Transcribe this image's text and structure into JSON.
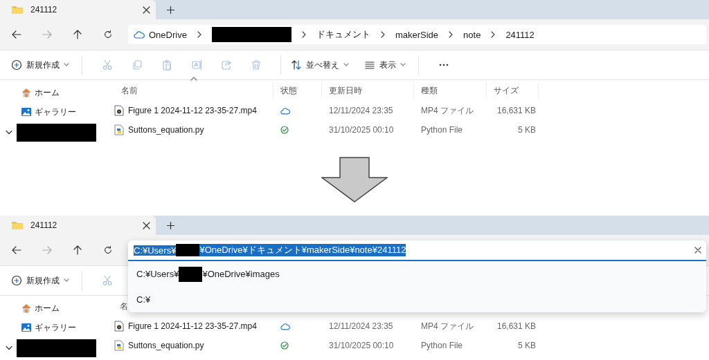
{
  "panels": [
    {
      "tab": {
        "title": "241112"
      },
      "address": {
        "kind": "breadcrumb",
        "crumbs": [
          {
            "kind": "cloud",
            "label": "OneDrive"
          },
          {
            "kind": "redacted"
          },
          {
            "kind": "folder",
            "label": "ドキュメント"
          },
          {
            "kind": "folder",
            "label": "makerSide"
          },
          {
            "kind": "folder",
            "label": "note"
          },
          {
            "kind": "folder",
            "label": "241112"
          }
        ]
      },
      "toolbar": [
        {
          "kind": "new",
          "label": "新規作成",
          "disabled": false
        },
        {
          "kind": "cut",
          "disabled": true
        },
        {
          "kind": "copy",
          "disabled": true
        },
        {
          "kind": "paste",
          "disabled": true
        },
        {
          "kind": "rename",
          "disabled": true
        },
        {
          "kind": "share",
          "disabled": true
        },
        {
          "kind": "delete",
          "disabled": true
        },
        {
          "kind": "sort",
          "label": "並べ替え",
          "disabled": false
        },
        {
          "kind": "view",
          "label": "表示",
          "disabled": false
        },
        {
          "kind": "more"
        }
      ],
      "sidebar": [
        {
          "kind": "home",
          "label": "ホーム"
        },
        {
          "kind": "gallery",
          "label": "ギャラリー"
        },
        {
          "kind": "redacted",
          "expanded": true
        }
      ],
      "columns": [
        {
          "label": "名前",
          "sorted": true
        },
        {
          "label": "状態",
          "sorted": false
        },
        {
          "label": "更新日時",
          "sorted": false
        },
        {
          "label": "種類",
          "sorted": false
        },
        {
          "label": "サイズ",
          "sorted": false
        }
      ],
      "rows": [
        {
          "kind": "video",
          "name": "Figure 1 2024-11-12 23-35-27.mp4",
          "status": {
            "kind": "cloud"
          },
          "modified": "12/11/2024 23:35",
          "type": "MP4 ファイル",
          "size": "16,631 KB"
        },
        {
          "kind": "python",
          "name": "Suttons_equation.py",
          "status": {
            "kind": "synced"
          },
          "modified": "31/10/2025 00:10",
          "type": "Python File",
          "size": "5 KB"
        }
      ]
    },
    {
      "tab": {
        "title": "241112"
      },
      "address": {
        "kind": "edit",
        "value_parts": [
          "C:¥Users¥",
          "¥OneDrive¥ドキュメント¥makerSide¥note¥241112"
        ],
        "text_selected": true,
        "suggestions": [
          {
            "parts": [
              "C:¥Users¥",
              "¥OneDrive¥images"
            ]
          },
          {
            "parts": [
              "C:¥"
            ]
          }
        ]
      },
      "toolbar": [
        {
          "kind": "new",
          "label": "新規作成",
          "disabled": false
        },
        {
          "kind": "cut",
          "disabled": true
        }
      ],
      "sidebar": [
        {
          "kind": "home",
          "label": "ホーム"
        },
        {
          "kind": "gallery",
          "label": "ギャラリー"
        },
        {
          "kind": "redacted",
          "expanded": true
        }
      ],
      "columns": [
        {
          "label": "名"
        }
      ],
      "rows": [
        {
          "kind": "video",
          "name": "Figure 1 2024-11-12 23-35-27.mp4",
          "status": {
            "kind": "cloud"
          },
          "modified": "12/11/2024 23:35",
          "type": "MP4 ファイル",
          "size": "16,631 KB"
        },
        {
          "kind": "python",
          "name": "Suttons_equation.py",
          "status": {
            "kind": "synced"
          },
          "modified": "31/10/2025 00:10",
          "type": "Python File",
          "size": "5 KB"
        }
      ]
    }
  ]
}
